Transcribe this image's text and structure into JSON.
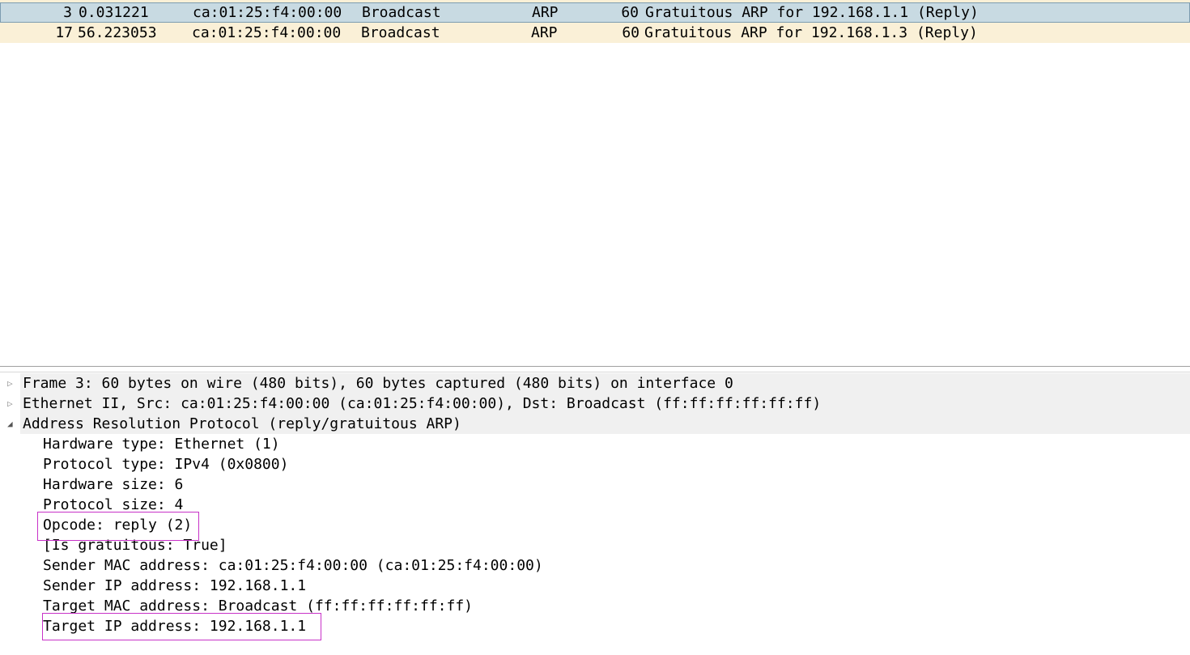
{
  "packet_list": {
    "rows": [
      {
        "no": "3",
        "time": "0.031221",
        "source": "ca:01:25:f4:00:00",
        "destination": "Broadcast",
        "protocol": "ARP",
        "length": "60",
        "info": "Gratuitous ARP for 192.168.1.1 (Reply)",
        "selected": true
      },
      {
        "no": "17",
        "time": "56.223053",
        "source": "ca:01:25:f4:00:00",
        "destination": "Broadcast",
        "protocol": "ARP",
        "length": "60",
        "info": "Gratuitous ARP for 192.168.1.3 (Reply)",
        "selected": false
      }
    ]
  },
  "details": {
    "tree": [
      {
        "label": "Frame 3: 60 bytes on wire (480 bits), 60 bytes captured (480 bits) on interface 0",
        "expanded": false
      },
      {
        "label": "Ethernet II, Src: ca:01:25:f4:00:00 (ca:01:25:f4:00:00), Dst: Broadcast (ff:ff:ff:ff:ff:ff)",
        "expanded": false
      },
      {
        "label": "Address Resolution Protocol (reply/gratuitous ARP)",
        "expanded": true
      }
    ],
    "arp_fields": [
      "Hardware type: Ethernet (1)",
      "Protocol type: IPv4 (0x0800)",
      "Hardware size: 6",
      "Protocol size: 4",
      "Opcode: reply (2)",
      "[Is gratuitous: True]",
      "Sender MAC address: ca:01:25:f4:00:00 (ca:01:25:f4:00:00)",
      "Sender IP address: 192.168.1.1",
      "Target MAC address: Broadcast (ff:ff:ff:ff:ff:ff)",
      "Target IP address: 192.168.1.1"
    ],
    "icons": {
      "collapsed": "triangle-right-icon",
      "expanded": "triangle-down-icon"
    }
  },
  "colors": {
    "selected_row": "#c8dae2",
    "arp_row": "#faf0d7",
    "highlight_box": "#c832c8"
  }
}
